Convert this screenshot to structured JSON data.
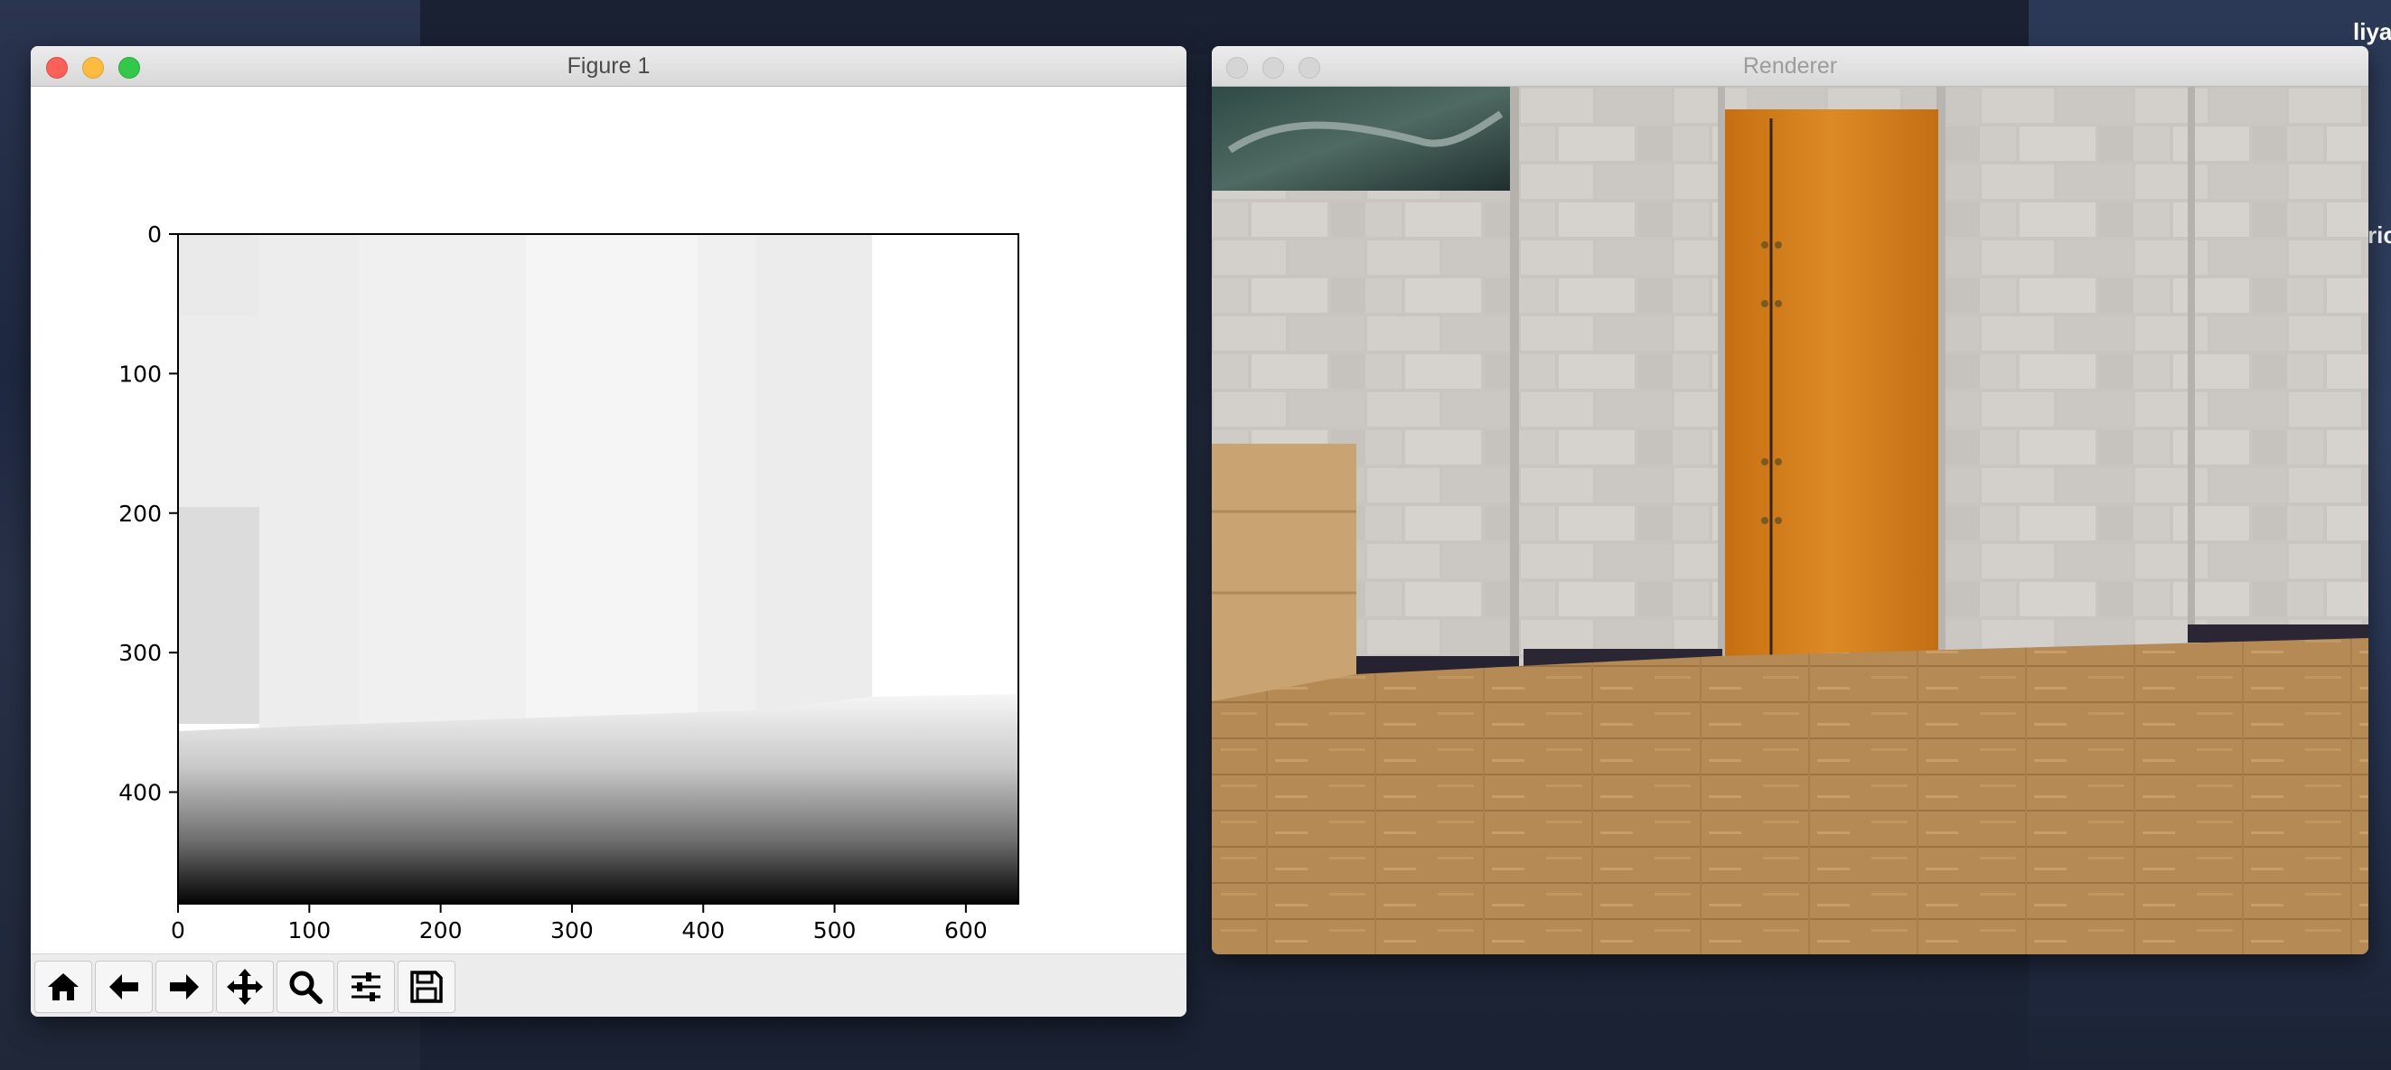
{
  "desktop": {
    "username_fragment": "liya",
    "side_text_fragment": "ric"
  },
  "figure_window": {
    "title": "Figure 1",
    "toolbar": [
      {
        "name": "home-icon",
        "tooltip": "Home"
      },
      {
        "name": "back-arrow-icon",
        "tooltip": "Back"
      },
      {
        "name": "forward-arrow-icon",
        "tooltip": "Forward"
      },
      {
        "name": "pan-move-icon",
        "tooltip": "Pan"
      },
      {
        "name": "zoom-magnifier-icon",
        "tooltip": "Zoom"
      },
      {
        "name": "configure-subplots-icon",
        "tooltip": "Subplots"
      },
      {
        "name": "save-floppy-icon",
        "tooltip": "Save"
      }
    ]
  },
  "renderer_window": {
    "title": "Renderer"
  },
  "chart_data": {
    "type": "heatmap",
    "description_kind": "grayscale depth image",
    "colormap": "gray",
    "xlim": [
      0,
      640
    ],
    "ylim": [
      480,
      0
    ],
    "x_ticks": [
      "0",
      "100",
      "200",
      "300",
      "400",
      "500",
      "600"
    ],
    "y_ticks": [
      "0",
      "100",
      "200",
      "300",
      "400"
    ],
    "x_tick_values": [
      0,
      100,
      200,
      300,
      400,
      500,
      600
    ],
    "y_tick_values": [
      0,
      100,
      200,
      300,
      400
    ],
    "title": "",
    "xlabel": "",
    "ylabel": ""
  }
}
